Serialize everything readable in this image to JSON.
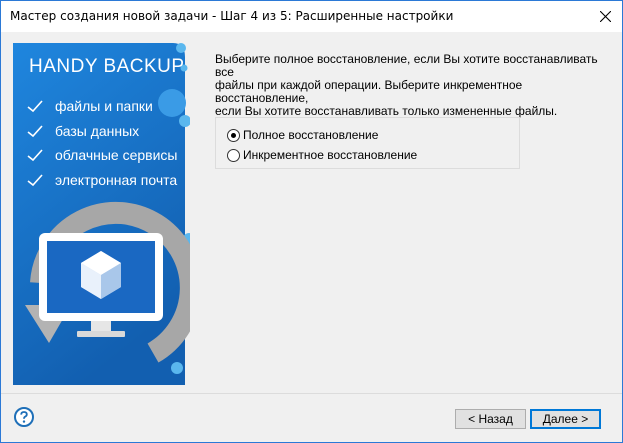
{
  "window": {
    "title": "Мастер создания новой задачи - Шаг 4 из 5: Расширенные настройки"
  },
  "banner": {
    "brand": "HANDY BACKUP",
    "features": [
      "файлы и папки",
      "базы данных",
      "облачные сервисы",
      "электронная почта"
    ]
  },
  "description": {
    "line1": "Выберите полное восстановление, если Вы хотите восстанавливать все",
    "line2": "файлы при каждой операции. Выберите инкрементное восстановление,",
    "line3": "если Вы хотите восстанавливать только измененные файлы."
  },
  "restore_options": [
    {
      "label": "Полное восстановление",
      "selected": true
    },
    {
      "label": "Инкрементное восстановление",
      "selected": false
    }
  ],
  "buttons": {
    "back": "< Назад",
    "next": "Далее >"
  },
  "icons": {
    "close": "close-icon",
    "help": "help-icon",
    "check": "check-icon",
    "monitor": "monitor-icon",
    "cube": "cube-icon"
  },
  "colors": {
    "banner_blue": "#1a73c9",
    "accent": "#0078d7",
    "help_blue": "#1e6fb8"
  }
}
